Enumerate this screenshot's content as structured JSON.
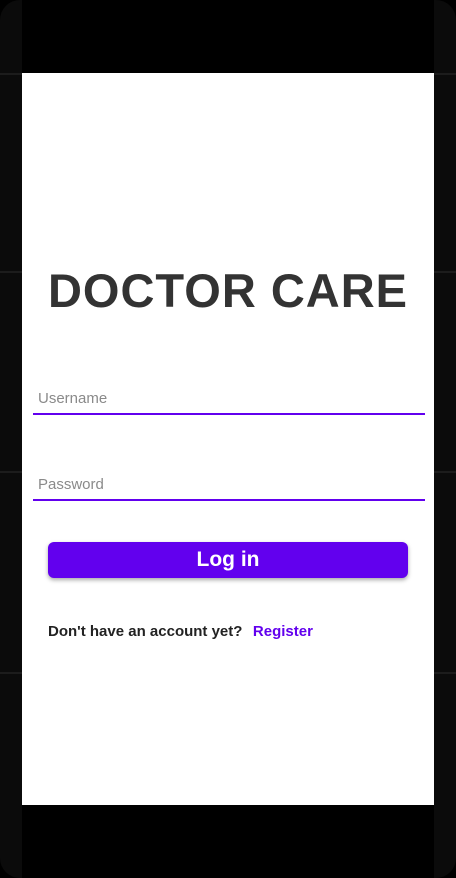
{
  "app": {
    "title": "DOCTOR CARE"
  },
  "login_form": {
    "username": {
      "placeholder": "Username",
      "value": ""
    },
    "password": {
      "placeholder": "Password",
      "value": ""
    },
    "login_button_label": "Log in"
  },
  "register": {
    "prompt": "Don't have an account yet?",
    "link_label": "Register"
  },
  "colors": {
    "accent": "#6200ee",
    "title_text": "#333333",
    "background": "#ffffff",
    "device_frame": "#000000"
  }
}
